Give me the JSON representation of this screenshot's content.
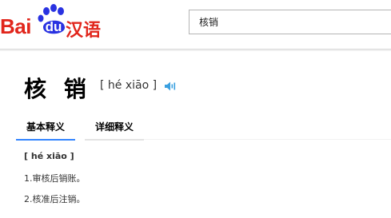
{
  "header": {
    "logo": {
      "text_bai": "Bai",
      "text_du": "du",
      "text_han": "汉语",
      "brand_red": "#e1261c",
      "brand_blue": "#2932e1"
    },
    "search": {
      "value": "核销"
    }
  },
  "word": {
    "title": "核 销",
    "pinyin": "[ hé xiāo ]",
    "sound_icon": "speaker-icon"
  },
  "tabs": [
    {
      "label": "基本释义",
      "active": true
    },
    {
      "label": "详细释义",
      "active": false
    }
  ],
  "definition": {
    "pinyin": "[ hé xiāo ]",
    "items": [
      "1.审核后销账。",
      "2.核准后注销。"
    ]
  },
  "colors": {
    "accent": "#3385ff",
    "speaker": "#3aa0e0"
  }
}
